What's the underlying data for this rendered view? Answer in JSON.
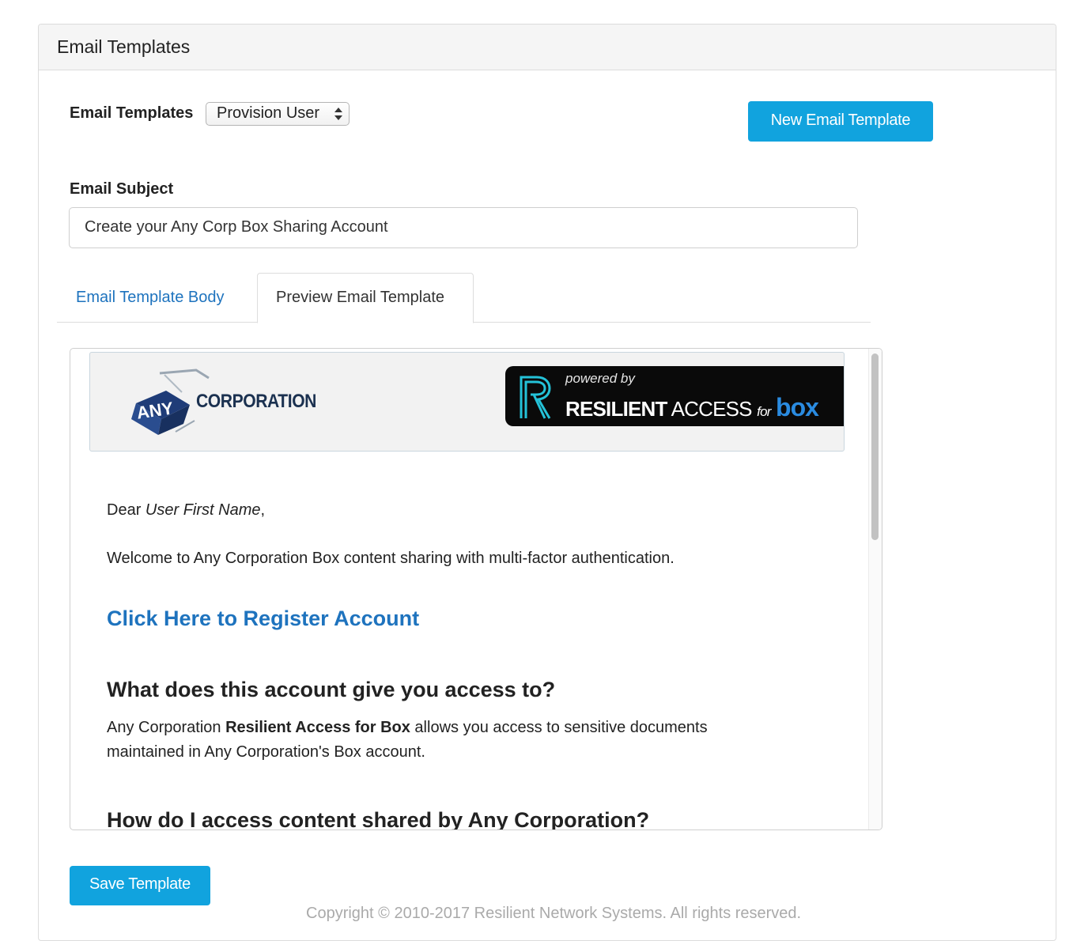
{
  "panel": {
    "title": "Email Templates"
  },
  "template_selector": {
    "label": "Email Templates",
    "selected": "Provision User"
  },
  "buttons": {
    "new_template": "New Email Template",
    "save_template": "Save Template"
  },
  "subject": {
    "label": "Email Subject",
    "value": "Create your Any Corp Box Sharing Account"
  },
  "tabs": [
    {
      "label": "Email Template Body",
      "active": false
    },
    {
      "label": "Preview Email Template",
      "active": true
    }
  ],
  "preview": {
    "header": {
      "corp_logo_mark": "ANY",
      "corp_logo_text": "CORPORATION",
      "powered_by": "powered by",
      "product_bold": "RESILIENT",
      "product_rest": "ACCESS",
      "product_for": "for",
      "product_box": "box"
    },
    "greeting_prefix": "Dear ",
    "greeting_name": "User First Name",
    "greeting_suffix": ",",
    "welcome": "Welcome to Any Corporation Box content sharing with multi-factor authentication.",
    "register_link": "Click Here to Register Account",
    "heading_1": "What does this account give you access to?",
    "access_prefix": "Any Corporation ",
    "access_bold": "Resilient Access for Box",
    "access_suffix": " allows you access to sensitive documents maintained in Any Corporation's Box account.",
    "heading_2": "How do I access content shared by Any Corporation?"
  },
  "footer": {
    "copyright": "Copyright © 2010-2017 Resilient Network Systems. All rights reserved."
  },
  "colors": {
    "accent": "#11a3de",
    "link": "#1e73be",
    "box_brand": "#2a8be0"
  },
  "icons": {
    "select_arrows": "up-down-arrows-icon",
    "resilient_logo": "resilient-r-logo",
    "corp_logo": "any-corporation-cube-logo"
  }
}
